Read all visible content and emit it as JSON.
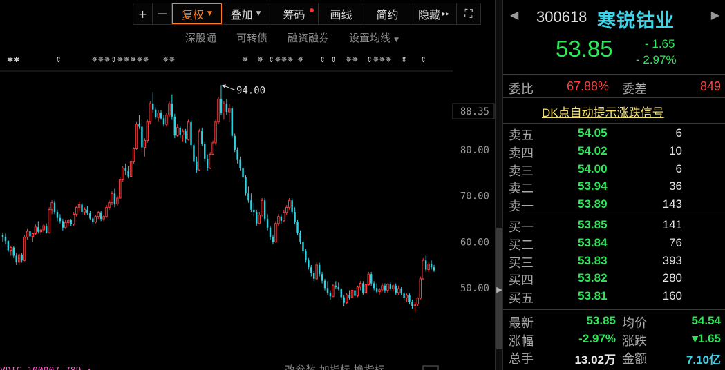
{
  "toolbar": {
    "plus": "+",
    "minus": "—",
    "fuquan": "复权",
    "diejia": "叠加",
    "chouma": "筹码",
    "huaxian": "画线",
    "jianyue": "简约",
    "yincang": "隐藏",
    "yincang_arrow": "▸▸",
    "expand": "⛶"
  },
  "subbar": {
    "items": [
      "深股通",
      "可转债",
      "融资融券",
      "设置均线"
    ]
  },
  "colors": {
    "up": "#ff3b3b",
    "down": "#2ad4e4",
    "green": "#2ee85a",
    "accent": "#ff7a1f",
    "name": "#3fd3e8",
    "dk_link": "#f0e070"
  },
  "chart_data": {
    "type": "candlestick",
    "y_ticks": [
      "88.35",
      "80.00",
      "70.00",
      "60.00",
      "50.00"
    ],
    "ylim": [
      43,
      96
    ],
    "max_annotation": "94.00",
    "candles": [
      [
        61.5,
        62.0,
        60.0,
        61.0
      ],
      [
        61.0,
        61.8,
        59.5,
        60.2
      ],
      [
        60.2,
        60.5,
        57.8,
        58.2
      ],
      [
        58.2,
        59.2,
        57.0,
        58.8
      ],
      [
        58.8,
        59.0,
        56.5,
        57.0
      ],
      [
        57.0,
        57.5,
        55.0,
        55.6
      ],
      [
        55.6,
        57.5,
        55.0,
        57.2
      ],
      [
        57.2,
        57.6,
        55.5,
        56.0
      ],
      [
        56.0,
        61.5,
        55.8,
        61.0
      ],
      [
        61.0,
        62.8,
        60.5,
        62.3
      ],
      [
        62.3,
        62.8,
        60.8,
        61.2
      ],
      [
        61.2,
        62.0,
        60.0,
        61.8
      ],
      [
        61.8,
        63.8,
        61.5,
        63.2
      ],
      [
        63.2,
        64.5,
        61.8,
        62.2
      ],
      [
        62.2,
        63.0,
        61.5,
        62.6
      ],
      [
        62.6,
        64.0,
        62.0,
        63.5
      ],
      [
        63.5,
        64.0,
        61.8,
        62.0
      ],
      [
        62.0,
        67.5,
        61.8,
        67.0
      ],
      [
        67.0,
        69.0,
        66.0,
        68.5
      ],
      [
        68.5,
        69.0,
        66.0,
        66.5
      ],
      [
        66.5,
        67.0,
        64.5,
        65.2
      ],
      [
        65.2,
        66.0,
        64.0,
        64.5
      ],
      [
        64.5,
        65.0,
        62.5,
        63.1
      ],
      [
        63.1,
        64.8,
        62.8,
        64.2
      ],
      [
        64.2,
        65.0,
        63.5,
        64.7
      ],
      [
        64.7,
        65.0,
        63.5,
        63.8
      ],
      [
        63.8,
        66.5,
        63.5,
        66.0
      ],
      [
        66.0,
        67.8,
        65.5,
        67.5
      ],
      [
        67.5,
        68.8,
        66.8,
        68.1
      ],
      [
        68.1,
        68.5,
        66.0,
        66.5
      ],
      [
        66.5,
        67.5,
        65.8,
        67.0
      ],
      [
        67.0,
        67.8,
        65.8,
        66.2
      ],
      [
        66.2,
        66.8,
        64.8,
        65.1
      ],
      [
        65.1,
        65.5,
        63.8,
        64.3
      ],
      [
        64.3,
        65.8,
        64.0,
        65.5
      ],
      [
        65.5,
        66.8,
        65.0,
        66.4
      ],
      [
        66.4,
        66.8,
        64.5,
        65.0
      ],
      [
        65.0,
        65.8,
        64.5,
        65.5
      ],
      [
        65.5,
        68.0,
        65.2,
        67.5
      ],
      [
        67.5,
        69.0,
        67.0,
        68.5
      ],
      [
        68.5,
        71.0,
        68.0,
        70.5
      ],
      [
        70.5,
        71.5,
        67.5,
        68.2
      ],
      [
        68.2,
        70.0,
        67.8,
        69.5
      ],
      [
        69.5,
        74.0,
        69.2,
        73.5
      ],
      [
        73.5,
        76.5,
        73.0,
        76.0
      ],
      [
        76.0,
        77.0,
        74.5,
        75.5
      ],
      [
        75.5,
        76.5,
        73.8,
        74.2
      ],
      [
        74.2,
        78.0,
        74.0,
        77.5
      ],
      [
        77.5,
        80.5,
        77.0,
        80.2
      ],
      [
        80.2,
        86.0,
        80.0,
        85.5
      ],
      [
        85.5,
        87.5,
        84.5,
        85.0
      ],
      [
        85.0,
        86.5,
        79.5,
        80.5
      ],
      [
        80.5,
        82.5,
        78.5,
        82.0
      ],
      [
        82.0,
        86.5,
        81.5,
        86.0
      ],
      [
        86.0,
        90.5,
        85.5,
        90.0
      ],
      [
        90.0,
        92.5,
        88.0,
        88.7
      ],
      [
        88.7,
        89.2,
        86.5,
        87.0
      ],
      [
        87.0,
        88.5,
        86.0,
        88.0
      ],
      [
        88.0,
        88.5,
        86.5,
        86.8
      ],
      [
        86.8,
        87.5,
        85.0,
        85.5
      ],
      [
        85.5,
        88.0,
        85.0,
        87.5
      ],
      [
        87.5,
        90.5,
        87.0,
        90.0
      ],
      [
        90.0,
        92.0,
        86.5,
        87.2
      ],
      [
        87.2,
        87.8,
        82.5,
        83.1
      ],
      [
        83.1,
        85.5,
        82.8,
        84.8
      ],
      [
        84.8,
        85.2,
        82.5,
        83.2
      ],
      [
        83.2,
        84.5,
        81.8,
        84.0
      ],
      [
        84.0,
        84.5,
        81.5,
        82.2
      ],
      [
        82.2,
        86.5,
        82.0,
        86.0
      ],
      [
        86.0,
        86.5,
        80.5,
        81.0
      ],
      [
        81.0,
        81.5,
        77.0,
        77.5
      ],
      [
        77.5,
        78.5,
        75.0,
        75.6
      ],
      [
        75.6,
        84.5,
        75.5,
        84.0
      ],
      [
        84.0,
        84.8,
        80.8,
        81.3
      ],
      [
        81.3,
        81.8,
        77.5,
        78.0
      ],
      [
        78.0,
        79.0,
        75.5,
        76.0
      ],
      [
        76.0,
        79.5,
        75.8,
        79.0
      ],
      [
        79.0,
        82.0,
        78.8,
        81.5
      ],
      [
        81.5,
        86.5,
        81.0,
        86.0
      ],
      [
        86.0,
        91.5,
        85.5,
        91.0
      ],
      [
        91.0,
        94.0,
        87.5,
        88.0
      ],
      [
        88.0,
        90.5,
        86.5,
        90.0
      ],
      [
        90.0,
        91.0,
        87.5,
        88.2
      ],
      [
        88.2,
        90.0,
        86.0,
        89.0
      ],
      [
        89.0,
        89.5,
        82.5,
        83.0
      ],
      [
        83.0,
        83.5,
        79.5,
        80.0
      ],
      [
        80.0,
        80.5,
        77.0,
        77.8
      ],
      [
        77.8,
        78.5,
        75.5,
        76.0
      ],
      [
        76.0,
        76.5,
        73.5,
        74.0
      ],
      [
        74.0,
        74.5,
        70.0,
        70.5
      ],
      [
        70.5,
        72.0,
        68.5,
        69.0
      ],
      [
        69.0,
        70.5,
        66.5,
        67.0
      ],
      [
        67.0,
        68.5,
        65.5,
        66.5
      ],
      [
        66.5,
        67.0,
        63.5,
        64.0
      ],
      [
        64.0,
        66.5,
        63.8,
        65.8
      ],
      [
        65.8,
        69.5,
        65.5,
        69.0
      ],
      [
        69.0,
        69.5,
        64.5,
        65.0
      ],
      [
        65.0,
        66.0,
        62.5,
        63.1
      ],
      [
        63.1,
        63.5,
        60.5,
        61.0
      ],
      [
        61.0,
        61.5,
        59.5,
        60.0
      ],
      [
        60.0,
        64.5,
        59.8,
        64.0
      ],
      [
        64.0,
        66.0,
        63.5,
        65.5
      ],
      [
        65.5,
        66.0,
        64.0,
        64.6
      ],
      [
        64.6,
        67.0,
        64.3,
        66.4
      ],
      [
        66.4,
        68.0,
        65.8,
        67.5
      ],
      [
        67.5,
        69.5,
        67.0,
        69.0
      ],
      [
        69.0,
        69.5,
        66.0,
        66.5
      ],
      [
        66.5,
        67.5,
        63.8,
        64.3
      ],
      [
        64.3,
        64.8,
        61.5,
        62.0
      ],
      [
        62.0,
        62.5,
        59.5,
        60.0
      ],
      [
        60.0,
        60.5,
        57.5,
        58.0
      ],
      [
        58.0,
        58.5,
        55.5,
        56.0
      ],
      [
        56.0,
        56.5,
        54.0,
        54.5
      ],
      [
        54.5,
        55.0,
        52.5,
        53.2
      ],
      [
        53.2,
        53.8,
        51.5,
        52.0
      ],
      [
        52.0,
        55.5,
        51.8,
        55.0
      ],
      [
        55.0,
        55.5,
        52.5,
        53.0
      ],
      [
        53.0,
        53.5,
        51.0,
        51.6
      ],
      [
        51.6,
        52.0,
        49.5,
        50.0
      ],
      [
        50.0,
        51.5,
        48.5,
        49.0
      ],
      [
        49.0,
        49.5,
        47.5,
        48.2
      ],
      [
        48.2,
        50.8,
        48.0,
        50.5
      ],
      [
        50.5,
        51.5,
        49.8,
        50.2
      ],
      [
        50.2,
        51.2,
        49.5,
        49.8
      ],
      [
        49.8,
        50.0,
        47.5,
        48.0
      ],
      [
        48.0,
        48.5,
        46.0,
        46.8
      ],
      [
        46.8,
        49.0,
        46.5,
        48.5
      ],
      [
        48.5,
        49.5,
        47.5,
        47.9
      ],
      [
        47.9,
        49.8,
        47.7,
        49.5
      ],
      [
        49.5,
        50.0,
        47.8,
        48.3
      ],
      [
        48.3,
        50.5,
        48.0,
        50.2
      ],
      [
        50.2,
        51.5,
        49.5,
        51.0
      ],
      [
        51.0,
        51.5,
        48.5,
        49.0
      ],
      [
        49.0,
        51.0,
        48.8,
        50.7
      ],
      [
        50.7,
        53.5,
        50.5,
        53.0
      ],
      [
        53.0,
        53.5,
        50.5,
        51.0
      ],
      [
        51.0,
        51.5,
        49.5,
        50.0
      ],
      [
        50.0,
        51.0,
        48.8,
        49.2
      ],
      [
        49.2,
        50.0,
        48.5,
        49.6
      ],
      [
        49.6,
        51.0,
        49.2,
        50.5
      ],
      [
        50.5,
        51.0,
        49.0,
        49.5
      ],
      [
        49.5,
        51.0,
        49.0,
        50.8
      ],
      [
        50.8,
        51.2,
        49.5,
        49.8
      ],
      [
        49.8,
        50.8,
        49.2,
        50.5
      ],
      [
        50.5,
        51.0,
        48.5,
        49.0
      ],
      [
        49.0,
        50.5,
        48.5,
        49.9
      ],
      [
        49.9,
        50.2,
        48.5,
        48.8
      ],
      [
        48.8,
        49.2,
        47.5,
        47.9
      ],
      [
        47.9,
        48.8,
        47.0,
        48.4
      ],
      [
        48.4,
        48.8,
        46.5,
        47.0
      ],
      [
        47.0,
        47.5,
        45.5,
        46.1
      ],
      [
        46.1,
        47.0,
        44.8,
        46.5
      ],
      [
        46.5,
        48.0,
        46.0,
        47.8
      ],
      [
        47.8,
        52.5,
        47.5,
        52.0
      ],
      [
        52.0,
        56.5,
        51.8,
        56.0
      ],
      [
        56.0,
        57.0,
        53.5,
        54.0
      ],
      [
        54.0,
        55.5,
        53.5,
        55.2
      ],
      [
        55.2,
        56.0,
        54.0,
        54.5
      ],
      [
        54.5,
        55.0,
        53.5,
        53.85
      ]
    ]
  },
  "quote": {
    "nav_left": "◀",
    "nav_right": "▶",
    "code": "300618",
    "name": "寒锐钴业",
    "price": "53.85",
    "change": "- 1.65",
    "change_pct": "- 2.97%",
    "weibi_label": "委比",
    "weibi_value": "67.88%",
    "weicha_label": "委差",
    "weicha_value": "849",
    "dk_text": "DK点自动提示涨跌信号"
  },
  "sell_orders": [
    {
      "label": "卖五",
      "price": "54.05",
      "vol": "6"
    },
    {
      "label": "卖四",
      "price": "54.02",
      "vol": "10"
    },
    {
      "label": "卖三",
      "price": "54.00",
      "vol": "6"
    },
    {
      "label": "卖二",
      "price": "53.94",
      "vol": "36"
    },
    {
      "label": "卖一",
      "price": "53.89",
      "vol": "143"
    }
  ],
  "buy_orders": [
    {
      "label": "买一",
      "price": "53.85",
      "vol": "141"
    },
    {
      "label": "买二",
      "price": "53.84",
      "vol": "76"
    },
    {
      "label": "买三",
      "price": "53.83",
      "vol": "393"
    },
    {
      "label": "买四",
      "price": "53.82",
      "vol": "280"
    },
    {
      "label": "买五",
      "price": "53.81",
      "vol": "160"
    }
  ],
  "stats": {
    "latest_label": "最新",
    "latest_value": "53.85",
    "avg_label": "均价",
    "avg_value": "54.54",
    "pct_label": "涨幅",
    "pct_value": "-2.97%",
    "chg_label": "涨跌",
    "chg_value": "▾1.65",
    "vol_label": "总手",
    "vol_value": "13.02万",
    "amount_label": "金额",
    "amount_value": "7.10亿"
  }
}
